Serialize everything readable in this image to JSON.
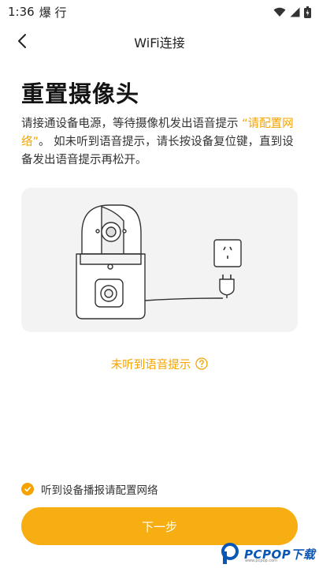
{
  "status_bar": {
    "time": "1:36",
    "notif_text": "爆 行"
  },
  "nav": {
    "title": "WiFi连接"
  },
  "heading": "重置摄像头",
  "description": {
    "part1": "请接通设备电源，等待摄像机发出语音提示 ",
    "highlight": "“请配置网络”",
    "part2": "。 如未听到语音提示，请长按设备复位键，直到设备发出语音提示再松开。"
  },
  "hint_link": {
    "label": "未听到语音提示",
    "icon": "help-circle-icon"
  },
  "confirm": {
    "label": "听到设备播报请配置网络",
    "checked": true
  },
  "next_button": {
    "label": "下一步"
  },
  "watermark": {
    "brand": "PCPOP下载",
    "sub": "www.pcpop.com"
  },
  "colors": {
    "accent": "#f5a300",
    "button": "#f7ae13",
    "illustration_bg": "#f3f3f3"
  }
}
